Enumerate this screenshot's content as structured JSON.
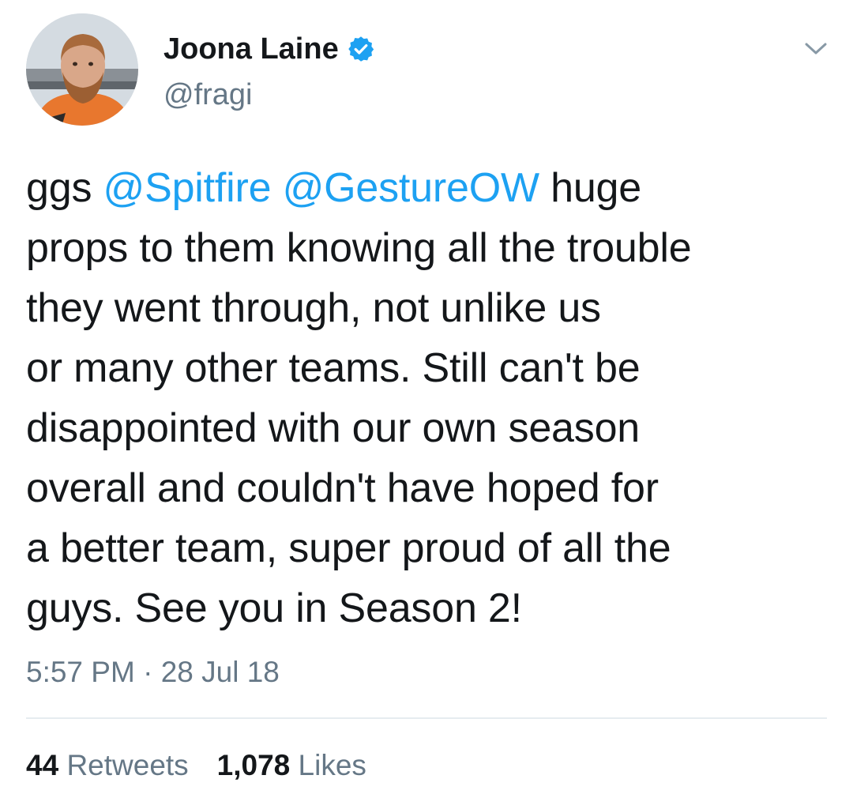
{
  "author": {
    "name": "Joona Laine",
    "handle": "@fragi",
    "verified": true
  },
  "tweet": {
    "lines": [
      [
        {
          "text": "ggs "
        },
        {
          "text": "@Spitfire",
          "mention": true
        },
        {
          "text": " "
        },
        {
          "text": "@GestureOW",
          "mention": true
        },
        {
          "text": " huge"
        }
      ],
      [
        {
          "text": "props to them knowing all the trouble"
        }
      ],
      [
        {
          "text": "they went through, not unlike us"
        }
      ],
      [
        {
          "text": "or many other teams. Still can't be"
        }
      ],
      [
        {
          "text": "disappointed with our own season"
        }
      ],
      [
        {
          "text": "overall and couldn't have hoped for"
        }
      ],
      [
        {
          "text": "a better team, super proud of all the"
        }
      ],
      [
        {
          "text": "guys. See you in Season 2!"
        }
      ]
    ],
    "time": "5:57 PM",
    "separator": "·",
    "date": "28 Jul 18"
  },
  "stats": {
    "retweets_count": "44",
    "retweets_label": "Retweets",
    "likes_count": "1,078",
    "likes_label": "Likes"
  },
  "colors": {
    "text": "#14171a",
    "secondary": "#657786",
    "accent": "#1da1f2",
    "divider": "#e6ecf0"
  },
  "icons": {
    "verified": "verified-badge-icon",
    "chevron": "chevron-down-icon"
  }
}
